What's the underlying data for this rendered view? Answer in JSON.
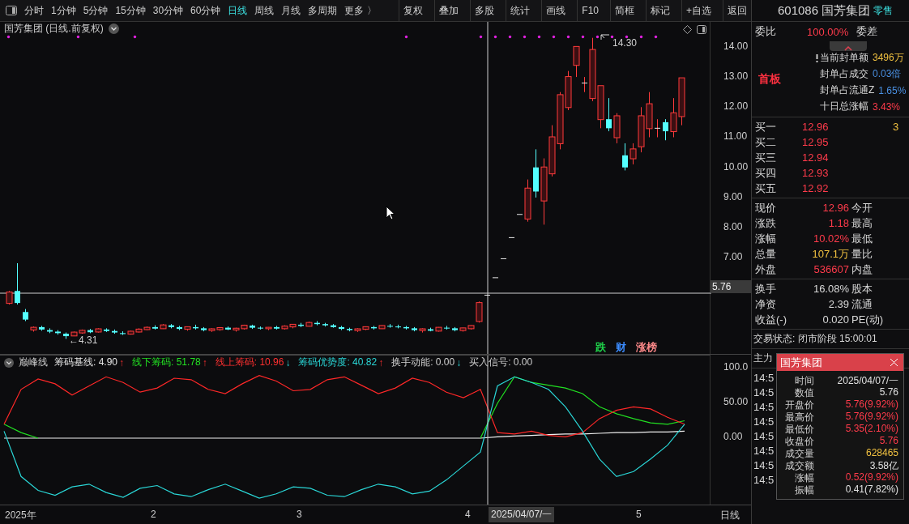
{
  "toolbar": {
    "periods": [
      {
        "label": "分时",
        "selected": false
      },
      {
        "label": "1分钟",
        "selected": false
      },
      {
        "label": "5分钟",
        "selected": false
      },
      {
        "label": "15分钟",
        "selected": false
      },
      {
        "label": "30分钟",
        "selected": false
      },
      {
        "label": "60分钟",
        "selected": false
      },
      {
        "label": "日线",
        "selected": true
      },
      {
        "label": "周线",
        "selected": false
      },
      {
        "label": "月线",
        "selected": false
      },
      {
        "label": "多周期",
        "selected": false
      },
      {
        "label": "更多 〉",
        "selected": false
      }
    ],
    "buttons": [
      "复权",
      "叠加",
      "多股",
      "统计",
      "画线",
      "F10",
      "简框",
      "标记",
      "+自选",
      "返回"
    ]
  },
  "chart": {
    "title": "国芳集团 (日线.前复权)",
    "cursor_price": "5.76",
    "chart_data": {
      "type": "candlestick",
      "ylim": [
        3.81,
        14.83
      ],
      "categories": [
        null,
        null,
        null,
        null,
        null,
        null,
        null,
        null,
        null,
        null,
        null,
        null,
        null,
        null,
        null,
        null,
        null,
        null,
        null,
        null,
        null,
        null,
        null,
        null,
        null,
        null,
        null,
        null,
        null,
        null,
        null,
        null,
        null,
        null,
        null,
        null,
        null,
        null,
        null,
        null,
        null,
        null,
        null,
        null,
        null,
        null,
        null,
        null,
        null,
        null,
        null,
        null,
        null,
        null,
        null,
        null,
        null,
        null,
        null,
        null,
        null,
        null,
        null,
        null,
        null,
        null,
        null,
        null,
        null,
        null,
        null,
        null,
        null,
        null,
        null,
        null,
        null,
        null,
        null,
        null,
        null,
        null,
        null,
        null
      ],
      "yticks": [
        {
          "value": 14,
          "label": "14.00"
        },
        {
          "value": 13,
          "label": "13.00"
        },
        {
          "value": 12,
          "label": "12.00"
        },
        {
          "value": 11,
          "label": "11.00"
        },
        {
          "value": 10,
          "label": "10.00"
        },
        {
          "value": 9,
          "label": "9.00"
        },
        {
          "value": 8,
          "label": "8.00"
        },
        {
          "value": 7,
          "label": "7.00"
        }
      ],
      "ohlc": [
        [
          5.5,
          5.9,
          5.45,
          5.85
        ],
        [
          5.9,
          6.82,
          5.45,
          5.5
        ],
        [
          5.2,
          5.3,
          4.9,
          4.95
        ],
        [
          4.62,
          4.72,
          4.55,
          4.68
        ],
        [
          4.7,
          4.74,
          4.58,
          4.62
        ],
        [
          4.6,
          4.66,
          4.5,
          4.55
        ],
        [
          4.55,
          4.6,
          4.45,
          4.5
        ],
        [
          4.48,
          4.52,
          4.31,
          4.4
        ],
        [
          4.42,
          4.55,
          4.4,
          4.52
        ],
        [
          4.52,
          4.62,
          4.48,
          4.58
        ],
        [
          4.6,
          4.64,
          4.5,
          4.53
        ],
        [
          4.55,
          4.66,
          4.52,
          4.63
        ],
        [
          4.62,
          4.66,
          4.54,
          4.57
        ],
        [
          4.57,
          4.62,
          4.48,
          4.52
        ],
        [
          4.5,
          4.56,
          4.44,
          4.47
        ],
        [
          4.48,
          4.58,
          4.45,
          4.55
        ],
        [
          4.55,
          4.66,
          4.52,
          4.62
        ],
        [
          4.63,
          4.72,
          4.6,
          4.68
        ],
        [
          4.7,
          4.76,
          4.62,
          4.65
        ],
        [
          4.66,
          4.8,
          4.64,
          4.76
        ],
        [
          4.76,
          4.8,
          4.66,
          4.7
        ],
        [
          4.7,
          4.74,
          4.6,
          4.64
        ],
        [
          4.64,
          4.72,
          4.58,
          4.7
        ],
        [
          4.7,
          4.78,
          4.62,
          4.66
        ],
        [
          4.66,
          4.7,
          4.56,
          4.6
        ],
        [
          4.6,
          4.66,
          4.54,
          4.63
        ],
        [
          4.63,
          4.7,
          4.58,
          4.67
        ],
        [
          4.68,
          4.72,
          4.6,
          4.62
        ],
        [
          4.62,
          4.68,
          4.55,
          4.65
        ],
        [
          4.66,
          4.78,
          4.62,
          4.75
        ],
        [
          4.75,
          4.78,
          4.64,
          4.68
        ],
        [
          4.68,
          4.72,
          4.62,
          4.66
        ],
        [
          4.66,
          4.7,
          4.6,
          4.68
        ],
        [
          4.7,
          4.74,
          4.62,
          4.65
        ],
        [
          4.66,
          4.76,
          4.62,
          4.72
        ],
        [
          4.72,
          4.8,
          4.66,
          4.78
        ],
        [
          4.78,
          4.84,
          4.7,
          4.74
        ],
        [
          4.74,
          4.88,
          4.72,
          4.84
        ],
        [
          4.84,
          4.9,
          4.76,
          4.8
        ],
        [
          4.8,
          4.84,
          4.72,
          4.76
        ],
        [
          4.76,
          4.8,
          4.68,
          4.7
        ],
        [
          4.7,
          4.74,
          4.6,
          4.64
        ],
        [
          4.64,
          4.68,
          4.56,
          4.6
        ],
        [
          4.6,
          4.66,
          4.54,
          4.63
        ],
        [
          4.64,
          4.72,
          4.6,
          4.7
        ],
        [
          4.7,
          4.74,
          4.62,
          4.66
        ],
        [
          4.66,
          4.76,
          4.64,
          4.74
        ],
        [
          4.74,
          4.8,
          4.68,
          4.72
        ],
        [
          4.72,
          4.78,
          4.66,
          4.7
        ],
        [
          4.7,
          4.74,
          4.62,
          4.66
        ],
        [
          4.66,
          4.7,
          4.56,
          4.6
        ],
        [
          4.6,
          4.66,
          4.52,
          4.63
        ],
        [
          4.63,
          4.68,
          4.56,
          4.58
        ],
        [
          4.58,
          4.7,
          4.55,
          4.68
        ],
        [
          4.68,
          4.74,
          4.62,
          4.66
        ],
        [
          4.66,
          4.7,
          4.56,
          4.6
        ],
        [
          4.6,
          4.68,
          4.55,
          4.66
        ],
        [
          4.66,
          4.76,
          4.62,
          4.74
        ],
        [
          4.9,
          5.55,
          4.85,
          5.5
        ],
        [
          5.76,
          5.76,
          5.76,
          5.76
        ],
        [
          6.34,
          6.34,
          6.34,
          6.34
        ],
        [
          6.97,
          6.97,
          6.97,
          6.97
        ],
        [
          7.67,
          7.67,
          7.67,
          7.67
        ],
        [
          8.44,
          8.44,
          8.44,
          8.44
        ],
        [
          8.3,
          9.6,
          8.2,
          9.3
        ],
        [
          10.0,
          10.6,
          9.0,
          9.2
        ],
        [
          8.9,
          10.3,
          8.1,
          10.0
        ],
        [
          9.8,
          11.4,
          9.7,
          11.0
        ],
        [
          10.8,
          12.5,
          10.6,
          12.4
        ],
        [
          12.0,
          13.2,
          11.9,
          13.0
        ],
        [
          13.4,
          14.0,
          13.0,
          14.0
        ],
        [
          12.8,
          13.0,
          12.5,
          12.8
        ],
        [
          12.3,
          14.3,
          12.2,
          13.9
        ],
        [
          11.6,
          12.7,
          11.3,
          12.7
        ],
        [
          11.6,
          12.3,
          11.2,
          11.3
        ],
        [
          11.0,
          11.8,
          10.8,
          11.7
        ],
        [
          10.4,
          10.8,
          9.9,
          10.0
        ],
        [
          10.3,
          10.8,
          10.1,
          10.6
        ],
        [
          10.7,
          12.0,
          10.5,
          11.7
        ],
        [
          11.3,
          12.5,
          11.0,
          12.1
        ],
        [
          11.3,
          11.6,
          11.0,
          11.3
        ],
        [
          11.5,
          11.6,
          10.9,
          11.2
        ],
        [
          11.2,
          12.3,
          11.0,
          11.8
        ],
        [
          11.7,
          12.96,
          11.4,
          12.96
        ]
      ]
    },
    "high_mark": "14.30",
    "low_mark": "←4.31",
    "signals": [
      {
        "label": "跌",
        "color": "#1fd24a"
      },
      {
        "label": "财",
        "color": "#3b8cff"
      },
      {
        "label": "涨榜",
        "color": "#ff8a8a"
      }
    ]
  },
  "indicator": {
    "name": "巅峰线",
    "items": [
      {
        "label": "筹码基线: 4.90",
        "color": "#e6e6e6",
        "arrow": "↑",
        "rising": true
      },
      {
        "label": "线下筹码: 51.78",
        "color": "#22e022",
        "arrow": "↑",
        "rising": true
      },
      {
        "label": "线上筹码: 10.96",
        "color": "#ff3030",
        "arrow": "↓",
        "rising": false
      },
      {
        "label": "筹码优势度: 40.82",
        "color": "#2ad6d6",
        "arrow": "↑",
        "rising": true
      },
      {
        "label": "换手动能: 0.00",
        "arrow": "↓",
        "rising": false
      },
      {
        "label": "买入信号: 0.00"
      }
    ],
    "chart_data": {
      "type": "line",
      "ylim": [
        -96.5,
        118.6
      ],
      "yticks": [
        {
          "value": 100,
          "label": "100.0"
        },
        {
          "value": 50,
          "label": "50.00"
        },
        {
          "value": 0,
          "label": "0.00"
        }
      ],
      "series": [
        {
          "color": "#f0f0f0",
          "values": [
            0,
            0,
            0,
            0,
            0,
            0,
            0,
            0,
            0,
            0,
            0,
            0,
            0,
            0,
            0,
            0,
            0,
            0,
            0,
            0,
            0,
            0,
            0,
            0,
            0,
            0,
            0,
            0,
            0,
            2,
            3,
            4,
            5,
            6,
            6,
            7,
            8,
            8,
            9,
            9,
            10
          ]
        },
        {
          "color": "#22e022",
          "values": [
            20,
            8,
            0,
            null,
            null,
            null,
            null,
            null,
            null,
            null,
            null,
            null,
            null,
            null,
            null,
            null,
            null,
            null,
            null,
            null,
            null,
            null,
            null,
            null,
            null,
            null,
            null,
            null,
            0,
            50,
            88,
            80,
            76,
            72,
            64,
            45,
            35,
            28,
            22,
            20,
            25
          ]
        },
        {
          "color": "#ff2828",
          "values": [
            20,
            70,
            85,
            78,
            62,
            75,
            88,
            80,
            66,
            72,
            86,
            84,
            70,
            64,
            78,
            90,
            82,
            68,
            70,
            84,
            88,
            76,
            64,
            72,
            86,
            80,
            66,
            58,
            70,
            8,
            6,
            10,
            4,
            2,
            8,
            28,
            40,
            45,
            42,
            30,
            20
          ]
        },
        {
          "color": "#2ad6d6",
          "values": [
            10,
            -55,
            -75,
            -82,
            -70,
            -66,
            -78,
            -85,
            -72,
            -68,
            -80,
            -84,
            -74,
            -66,
            -76,
            -86,
            -80,
            -70,
            -72,
            -82,
            -84,
            -74,
            -66,
            -70,
            -80,
            -76,
            -60,
            -40,
            -20,
            75,
            88,
            80,
            70,
            45,
            10,
            -30,
            -55,
            -48,
            -30,
            -10,
            20
          ]
        }
      ]
    }
  },
  "time_axis": {
    "labels": [
      "2025年",
      "2",
      "3",
      "4",
      "5"
    ],
    "cursor_date": "2025/04/07/一",
    "period": "日线"
  },
  "panel": {
    "title": "601086 国芳集团",
    "tag": "零售",
    "ratio": {
      "label": "委比",
      "value": "100.00%",
      "label2": "委差"
    },
    "board": {
      "label": "首板",
      "stats": [
        {
          "label": "当前封单额",
          "value": "3496万",
          "color": "#f0c040"
        },
        {
          "label": "封单占成交",
          "value": "0.03倍",
          "color": "#4a90e2"
        },
        {
          "label": "封单占流通Z",
          "value": "1.65%",
          "color": "#4a90e2"
        },
        {
          "label": "十日总涨幅",
          "value": "3.43%",
          "color": "#ff3b4b"
        }
      ]
    },
    "bids": [
      {
        "label": "买一",
        "price": "12.96",
        "volume": "3"
      },
      {
        "label": "买二",
        "price": "12.95"
      },
      {
        "label": "买三",
        "price": "12.94"
      },
      {
        "label": "买四",
        "price": "12.93"
      },
      {
        "label": "买五",
        "price": "12.92"
      }
    ],
    "quotes": [
      {
        "label": "现价",
        "value": "12.96",
        "color": "#ff3b4b",
        "label2": "今开"
      },
      {
        "label": "涨跌",
        "value": "1.18",
        "color": "#ff3b4b",
        "label2": "最高"
      },
      {
        "label": "涨幅",
        "value": "10.02%",
        "color": "#ff3b4b",
        "label2": "最低"
      },
      {
        "label": "总量",
        "value": "107.1万",
        "color": "#f0c040",
        "label2": "量比"
      },
      {
        "label": "外盘",
        "value": "536607",
        "color": "#ff3b4b",
        "label2": "内盘"
      }
    ],
    "stats": [
      {
        "label": "换手",
        "value": "16.08%",
        "label2": "股本"
      },
      {
        "label": "净资",
        "value": "2.39",
        "label2": "流通"
      },
      {
        "label": "收益(-)",
        "value": "0.020",
        "label2": "PE(动)"
      }
    ],
    "status": "交易状态: 闭市阶段 15:00:01",
    "main_force": "主力",
    "ticks": [
      "14:5",
      "14:5",
      "14:5",
      "14:5",
      "14:5",
      "14:5",
      "14:5",
      "14:5"
    ]
  },
  "popup": {
    "title": "国芳集团",
    "rows": [
      {
        "label": "时间",
        "value": "2025/04/07/一",
        "color": "#e0e0e0"
      },
      {
        "label": "数值",
        "value": "5.76",
        "color": "#e0e0e0"
      },
      {
        "label": "开盘价",
        "value": "5.76(9.92%)",
        "color": "#ff3b4b"
      },
      {
        "label": "最高价",
        "value": "5.76(9.92%)",
        "color": "#ff3b4b"
      },
      {
        "label": "最低价",
        "value": "5.35(2.10%)",
        "color": "#ff3b4b"
      },
      {
        "label": "收盘价",
        "value": "5.76",
        "color": "#ff3b4b"
      },
      {
        "label": "成交量",
        "value": "628465",
        "color": "#f0c040"
      },
      {
        "label": "成交额",
        "value": "3.58亿",
        "color": "#e0e0e0"
      },
      {
        "label": "涨幅",
        "value": "0.52(9.92%)",
        "color": "#ff3b4b"
      },
      {
        "label": "振幅",
        "value": "0.41(7.82%)",
        "color": "#e0e0e0"
      }
    ]
  }
}
